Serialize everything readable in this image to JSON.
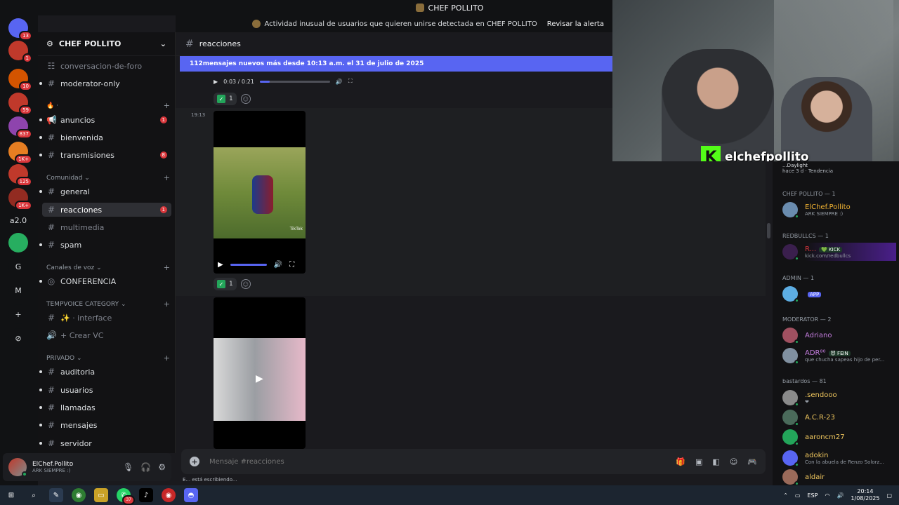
{
  "window": {
    "title": "CHEF POLLITO"
  },
  "alert": {
    "text": "Actividad inusual de usuarios que quieren unirse detectada en CHEF POLLITO",
    "action": "Revisar la alerta"
  },
  "rail": {
    "servers": [
      {
        "label": "",
        "badge": "13",
        "color": "#5865f2"
      },
      {
        "label": "",
        "badge": "1",
        "color": "#c0392b"
      },
      {
        "label": "",
        "badge": "10",
        "color": "#d35400"
      },
      {
        "label": "",
        "badge": "59",
        "color": "#c0392b"
      },
      {
        "label": "",
        "badge": "837",
        "color": "#8e44ad"
      },
      {
        "label": "",
        "badge": "1K+",
        "color": "#e67e22"
      },
      {
        "label": "",
        "badge": "125",
        "color": "#c0392b"
      },
      {
        "label": "",
        "badge": "1K+",
        "color": "#922b21"
      },
      {
        "label": "a2.0",
        "badge": "",
        "color": "#111214"
      },
      {
        "label": "",
        "badge": "",
        "color": "#27ae60"
      },
      {
        "label": "G",
        "badge": "",
        "color": "#111214"
      },
      {
        "label": "M",
        "badge": "",
        "color": "#111214"
      },
      {
        "label": "+",
        "badge": "",
        "color": "#111214"
      },
      {
        "label": "⊘",
        "badge": "",
        "color": "#111214"
      }
    ]
  },
  "sidebar": {
    "server_name": "CHEF POLLITO",
    "items": [
      {
        "type": "channel",
        "name": "conversacion-de-foro",
        "icon": "forum-icon",
        "muted": true
      },
      {
        "type": "channel",
        "name": "moderator-only",
        "icon": "hash-icon"
      },
      {
        "type": "category",
        "name": "🔥 ·"
      },
      {
        "type": "channel",
        "name": "anuncios",
        "icon": "announcement-icon",
        "count": "1"
      },
      {
        "type": "channel",
        "name": "bienvenida",
        "icon": "hash-icon"
      },
      {
        "type": "channel",
        "name": "transmisiones",
        "icon": "hash-icon",
        "count": "8"
      },
      {
        "type": "category",
        "name": "Comunidad ⌄"
      },
      {
        "type": "channel",
        "name": "general",
        "icon": "hash-icon"
      },
      {
        "type": "channel",
        "name": "reacciones",
        "icon": "hash-icon",
        "count": "1",
        "active": true
      },
      {
        "type": "channel",
        "name": "multimedia",
        "icon": "hash-icon",
        "muted": true
      },
      {
        "type": "channel",
        "name": "spam",
        "icon": "hash-icon"
      },
      {
        "type": "category",
        "name": "Canales de voz ⌄"
      },
      {
        "type": "channel",
        "name": "CONFERENCIA",
        "icon": "stage-icon",
        "muted": false
      },
      {
        "type": "category",
        "name": "TEMPVOICE CATEGORY ⌄"
      },
      {
        "type": "channel",
        "name": "✨ · interface",
        "icon": "hash-icon",
        "muted": true
      },
      {
        "type": "channel",
        "name": "+ Crear VC",
        "icon": "speaker-icon",
        "muted": true
      },
      {
        "type": "category",
        "name": "PRIVADO ⌄"
      },
      {
        "type": "channel",
        "name": "auditoria",
        "icon": "hash-icon"
      },
      {
        "type": "channel",
        "name": "usuarios",
        "icon": "hash-icon"
      },
      {
        "type": "channel",
        "name": "llamadas",
        "icon": "hash-icon"
      },
      {
        "type": "channel",
        "name": "mensajes",
        "icon": "hash-icon"
      },
      {
        "type": "channel",
        "name": "servidor",
        "icon": "hash-icon"
      }
    ]
  },
  "user": {
    "name": "ElChef.Pollito",
    "status": "ARK SIEMPRE :)"
  },
  "chat": {
    "channel": "reacciones",
    "new_messages": "112mensajes nuevos más desde 10:13 a.m. el 31 de julio de 2025",
    "audio_time": "0:03 / 0:21",
    "audio_progress": 0.14,
    "reaction_count": "1",
    "timestamp": "19:13",
    "tiktok_label": "TikTok",
    "placeholder": "Mensaje #reacciones",
    "typing": "E... está escribiendo..."
  },
  "stream": {
    "name": "elchefpollito",
    "logo": "K"
  },
  "members": {
    "activity_title": "...Daylight",
    "activity_meta": "hace 3 d · Tendencia",
    "groups": [
      {
        "title": "CHEF POLLITO — 1",
        "members": [
          {
            "name": "ElChef.Pollito",
            "sub": "ARK SIEMPRE :)",
            "color": "#f0b232"
          }
        ]
      },
      {
        "title": "REDBULLCS — 1",
        "members": [
          {
            "name": "R...",
            "tag": "💚 KICK",
            "sub": "kick.com/redbullcs",
            "color": "#da373c"
          }
        ]
      },
      {
        "title": "ADMIN — 1",
        "members": [
          {
            "name": "",
            "tag": "APP",
            "sub": "",
            "color": "#da373c"
          }
        ]
      },
      {
        "title": "MODERATOR — 2",
        "members": [
          {
            "name": "Adriano",
            "sub": "",
            "color": "#c27cdc"
          },
          {
            "name": "ADR⁸⁰",
            "tag": "😈 FEIN",
            "sub": "que chucha sapeas hijo de per...",
            "color": "#c27cdc"
          }
        ]
      },
      {
        "title": "bastardos — 81",
        "members": [
          {
            "name": ".sendooo",
            "sub": "❤",
            "color": "#f0c75e"
          },
          {
            "name": "A.C.R-23",
            "sub": "",
            "color": "#f0c75e"
          },
          {
            "name": "aaroncm27",
            "sub": "",
            "color": "#f0c75e"
          },
          {
            "name": "adokin",
            "sub": "Con la abuela de Renzo Solorz...",
            "color": "#f0c75e"
          },
          {
            "name": "aldair",
            "sub": "",
            "color": "#f0c75e"
          }
        ]
      }
    ]
  },
  "taskbar": {
    "whatsapp_badge": "37",
    "lang": "ESP",
    "time": "20:14",
    "date": "1/08/2025"
  }
}
